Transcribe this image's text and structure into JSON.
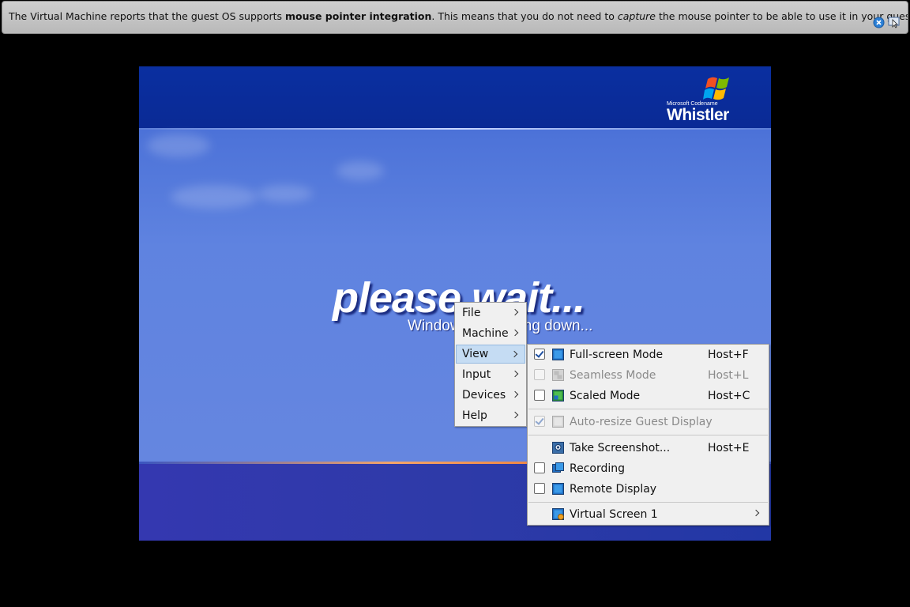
{
  "notification": {
    "text_1": "The Virtual Machine reports that the guest OS supports ",
    "bold": "mouse pointer integration",
    "text_2": ". This means that you do not need to ",
    "italic": "capture",
    "text_3": " the mouse pointer to be able to use it in your guest OS --"
  },
  "guest": {
    "logo_small": "Microsoft Codename",
    "logo_big": "Whistler",
    "wait": "please wait...",
    "status": "Windows is shutting down..."
  },
  "main_menu": {
    "items": [
      {
        "label": "File"
      },
      {
        "label": "Machine"
      },
      {
        "label": "View"
      },
      {
        "label": "Input"
      },
      {
        "label": "Devices"
      },
      {
        "label": "Help"
      }
    ]
  },
  "view_menu": {
    "fullscreen": {
      "label": "Full-screen Mode",
      "shortcut": "Host+F"
    },
    "seamless": {
      "label": "Seamless Mode",
      "shortcut": "Host+L"
    },
    "scaled": {
      "label": "Scaled Mode",
      "shortcut": "Host+C"
    },
    "autoresize": {
      "label": "Auto-resize Guest Display"
    },
    "screenshot": {
      "label": "Take Screenshot...",
      "shortcut": "Host+E"
    },
    "recording": {
      "label": "Recording"
    },
    "remote": {
      "label": "Remote Display"
    },
    "virtual_screen": {
      "label": "Virtual Screen 1"
    }
  },
  "colors": {
    "menu_highlight": "#c5dcf3",
    "guest_blue": "#5f7fd9",
    "top_band": "#0a2fa0"
  }
}
